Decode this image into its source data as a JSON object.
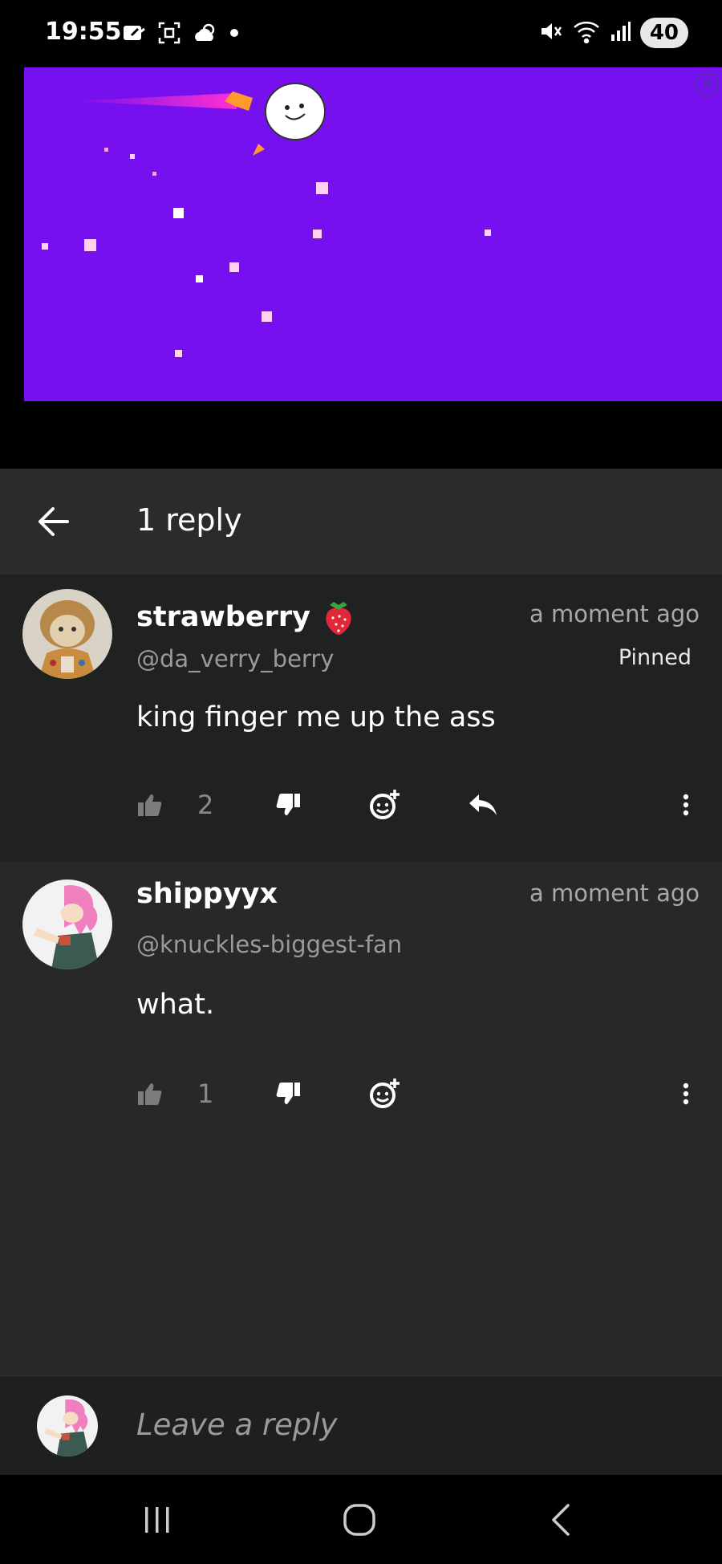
{
  "status_bar": {
    "time": "19:55",
    "battery": "40"
  },
  "header": {
    "title": "1 reply"
  },
  "comments": [
    {
      "username": "strawberry",
      "username_emoji": "strawberry-icon",
      "handle": "@da_verry_berry",
      "timestamp": "a moment ago",
      "badge": "Pinned",
      "text": "king finger me up the ass",
      "likes": "2"
    },
    {
      "username": "shippyyx",
      "handle": "@knuckles-biggest-fan",
      "timestamp": "a moment ago",
      "text": "what.",
      "likes": "1"
    }
  ],
  "reply_bar": {
    "placeholder": "Leave a reply"
  },
  "colors": {
    "game_background": "#7710ee",
    "header_background": "#2a2b2b",
    "pinned_comment_background": "#202222",
    "reply_comment_background": "#272828"
  }
}
